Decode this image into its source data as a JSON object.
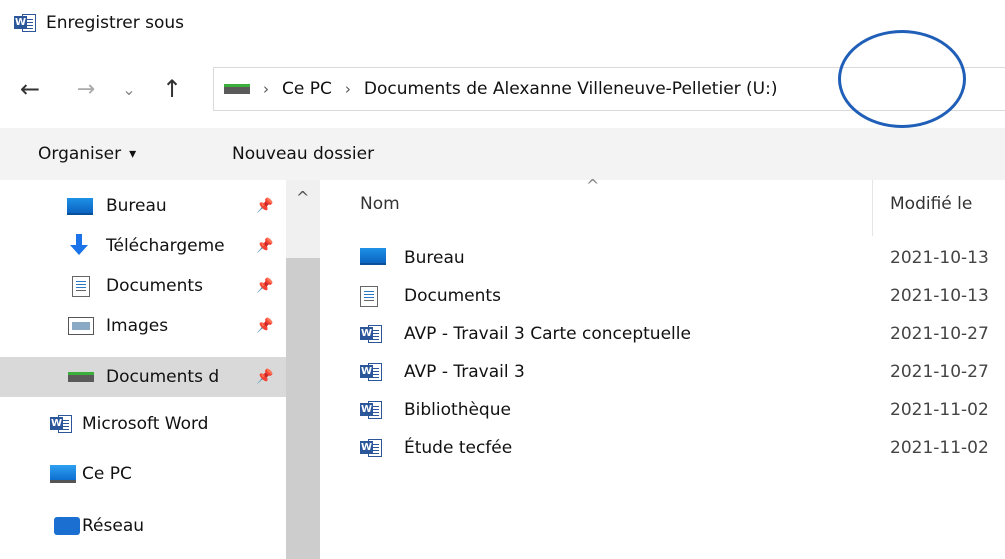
{
  "window": {
    "title": "Enregistrer sous",
    "app_icon": "word-icon"
  },
  "nav": {
    "back_icon": "←",
    "forward_icon": "→",
    "recent_icon": "⌄",
    "up_icon": "↑"
  },
  "address": {
    "sep": "›",
    "crumbs": [
      "Ce PC",
      "Documents de Alexanne Villeneuve-Pelletier (U:)"
    ]
  },
  "toolbar": {
    "organise_label": "Organiser",
    "organise_arrow": "▾",
    "new_folder_label": "Nouveau dossier"
  },
  "sidebar": {
    "pin_glyph": "📌",
    "scroll_up": "^",
    "items": [
      {
        "label": "Bureau",
        "icon": "desktop-icon"
      },
      {
        "label": "Téléchargeme",
        "icon": "download-icon"
      },
      {
        "label": "Documents",
        "icon": "documents-icon"
      },
      {
        "label": "Images",
        "icon": "images-icon"
      },
      {
        "label": "Documents d",
        "icon": "network-drive-icon"
      },
      {
        "label": "Microsoft Word",
        "icon": "word-icon"
      },
      {
        "label": "Ce PC",
        "icon": "pc-icon"
      },
      {
        "label": "Réseau",
        "icon": "network-icon"
      }
    ]
  },
  "filelist": {
    "sort_arrow": "^",
    "columns": {
      "name": "Nom",
      "modified": "Modifié le"
    },
    "rows": [
      {
        "name": "Bureau",
        "date": "2021-10-13",
        "icon": "desktop-icon"
      },
      {
        "name": "Documents",
        "date": "2021-10-13",
        "icon": "documents-icon"
      },
      {
        "name": "AVP - Travail 3 Carte conceptuelle",
        "date": "2021-10-27",
        "icon": "word-icon"
      },
      {
        "name": "AVP - Travail 3",
        "date": "2021-10-27",
        "icon": "word-icon"
      },
      {
        "name": "Bibliothèque",
        "date": "2021-11-02",
        "icon": "word-icon"
      },
      {
        "name": "Étude tecfée",
        "date": "2021-11-02",
        "icon": "word-icon"
      }
    ]
  },
  "colors": {
    "annotation": "#1f5fb8",
    "selection": "#d9d9d9",
    "toolbar_bg": "#f3f3f3"
  }
}
